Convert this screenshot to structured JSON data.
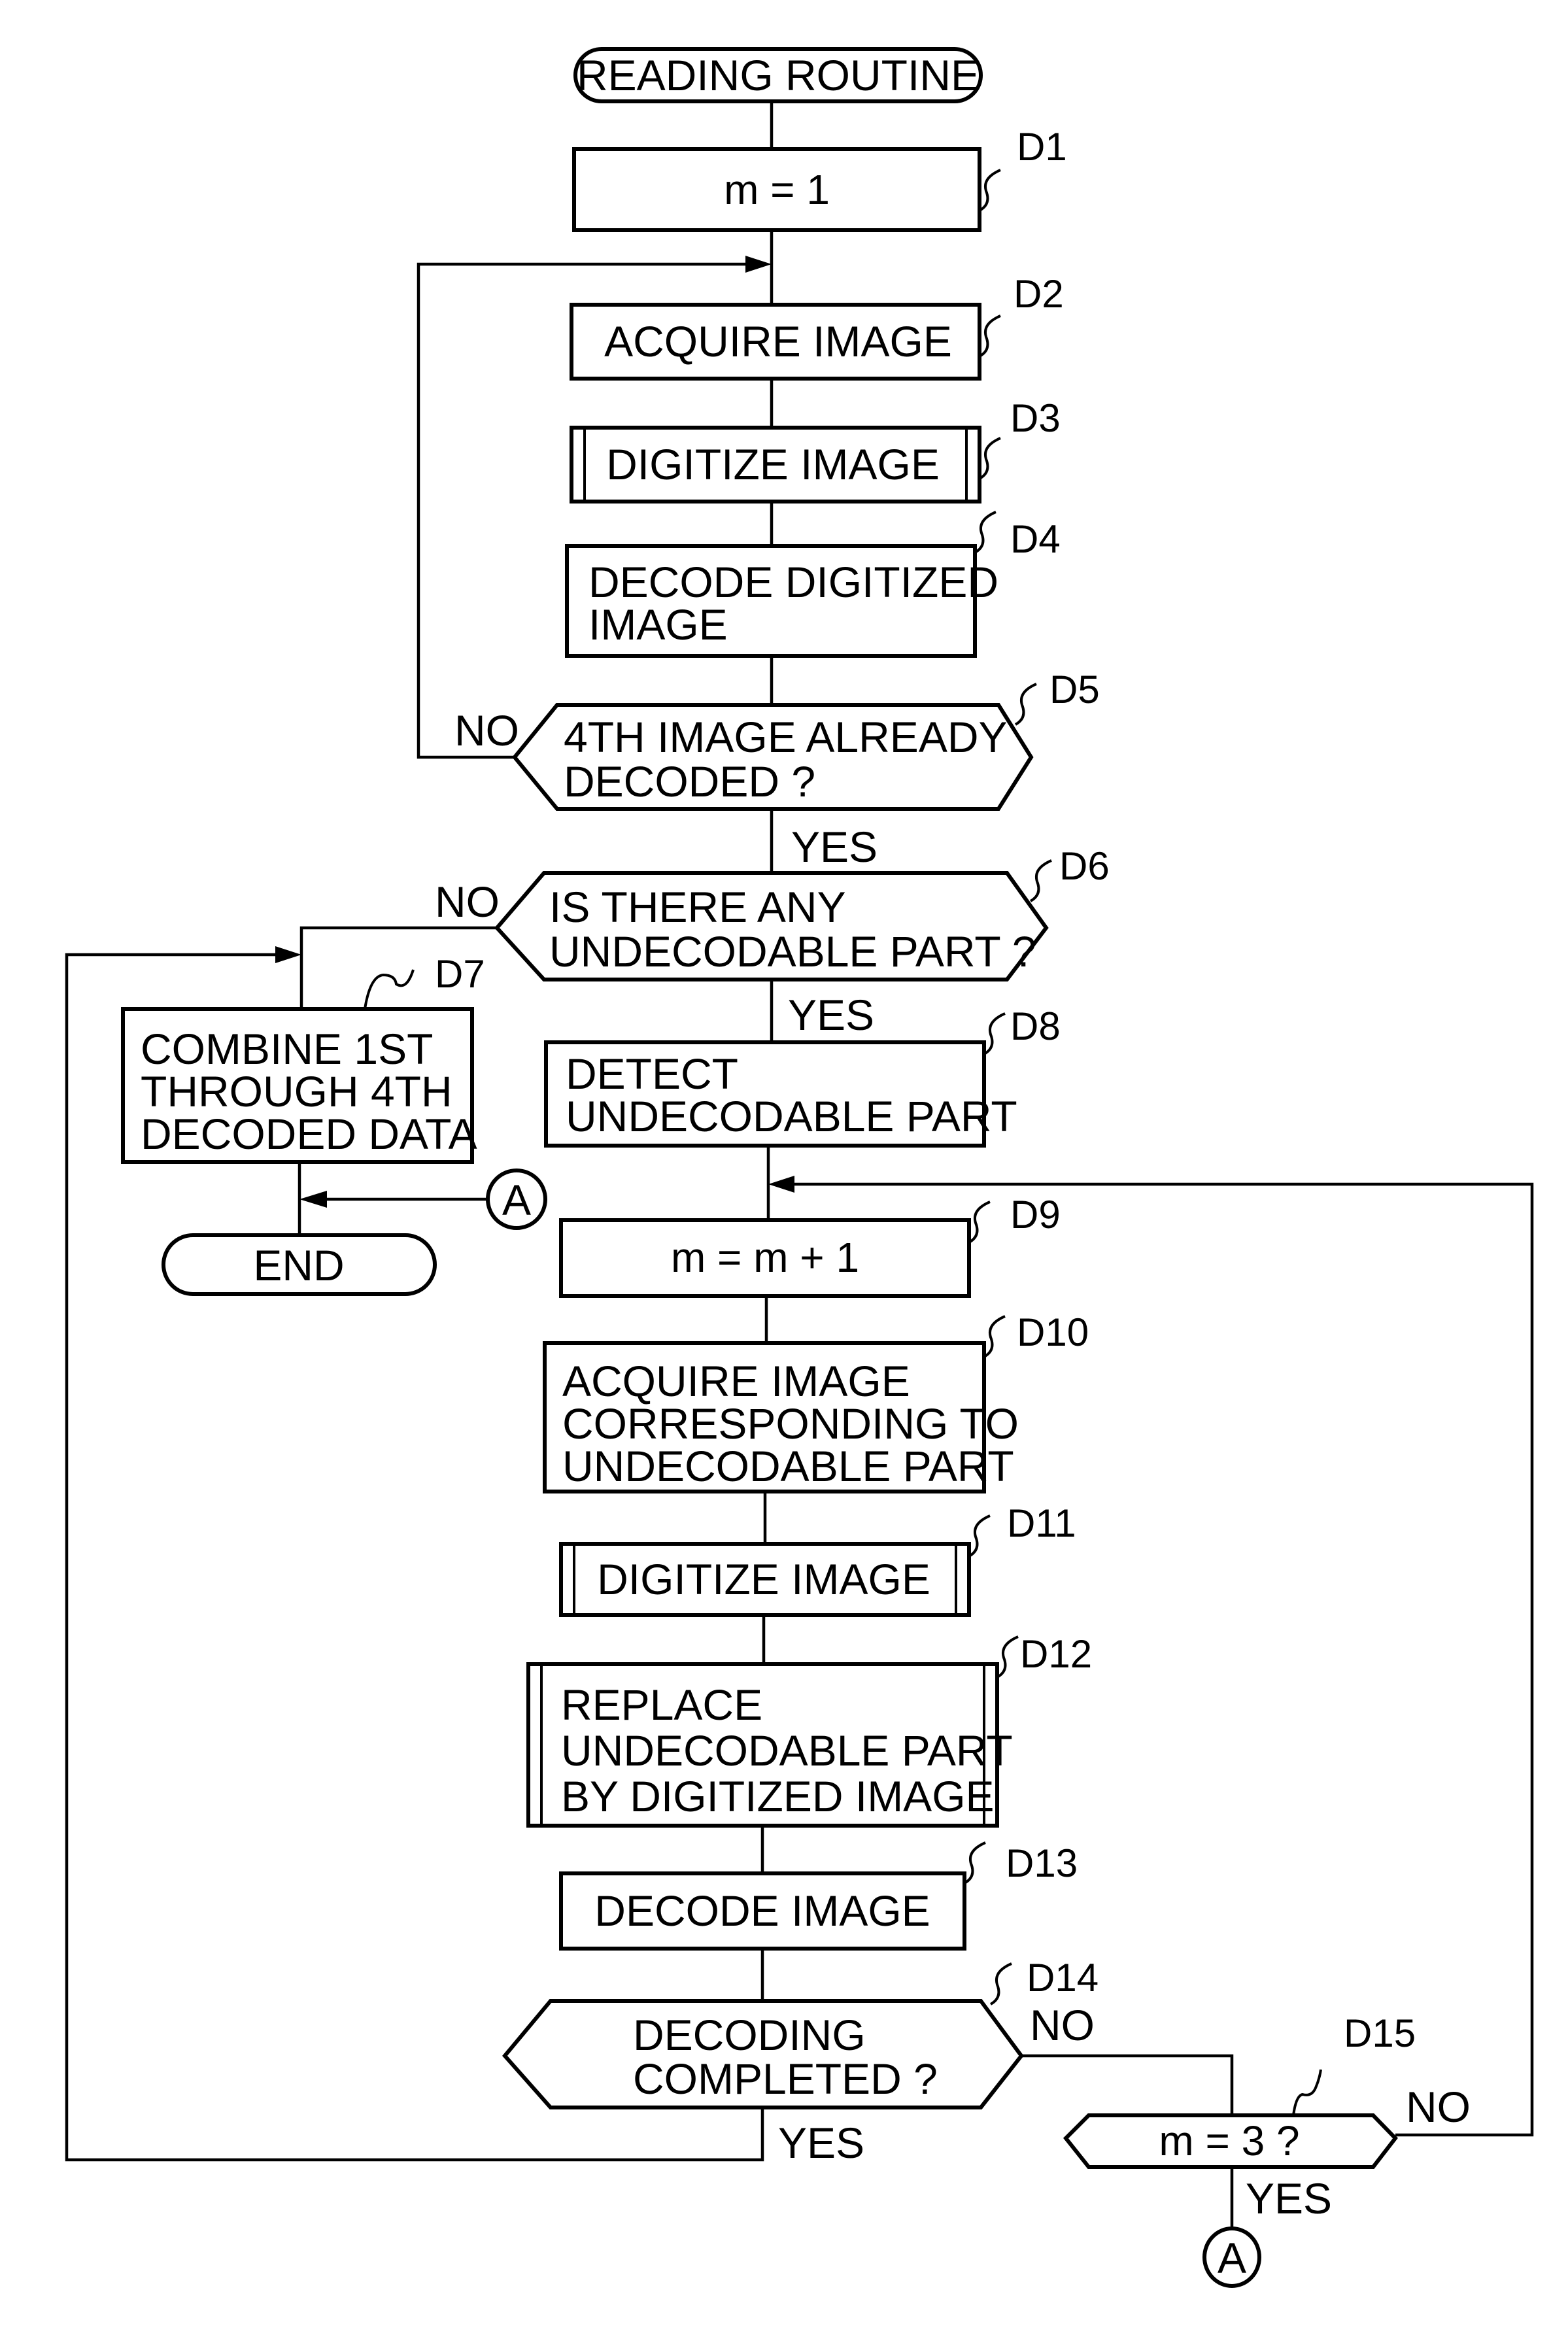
{
  "diagram": {
    "type": "flowchart",
    "start": {
      "label": "READING ROUTINE"
    },
    "end": {
      "label": "END"
    },
    "steps": [
      {
        "id": "D1",
        "kind": "process",
        "lines": [
          "m = 1"
        ]
      },
      {
        "id": "D2",
        "kind": "process",
        "lines": [
          "ACQUIRE IMAGE"
        ]
      },
      {
        "id": "D3",
        "kind": "subroutine",
        "lines": [
          "DIGITIZE IMAGE"
        ]
      },
      {
        "id": "D4",
        "kind": "process",
        "lines": [
          "DECODE DIGITIZED",
          "IMAGE"
        ]
      },
      {
        "id": "D5",
        "kind": "decision",
        "lines": [
          "4TH IMAGE ALREADY",
          "DECODED ?"
        ]
      },
      {
        "id": "D6",
        "kind": "decision",
        "lines": [
          "IS THERE ANY",
          "UNDECODABLE PART ?"
        ]
      },
      {
        "id": "D7",
        "kind": "process",
        "lines": [
          "COMBINE 1ST",
          "THROUGH 4TH",
          "DECODED DATA"
        ]
      },
      {
        "id": "D8",
        "kind": "process",
        "lines": [
          "DETECT",
          "UNDECODABLE PART"
        ]
      },
      {
        "id": "D9",
        "kind": "process",
        "lines": [
          "m = m + 1"
        ]
      },
      {
        "id": "D10",
        "kind": "process",
        "lines": [
          "ACQUIRE IMAGE",
          "CORRESPONDING TO",
          "UNDECODABLE PART"
        ]
      },
      {
        "id": "D11",
        "kind": "subroutine",
        "lines": [
          "DIGITIZE IMAGE"
        ]
      },
      {
        "id": "D12",
        "kind": "subroutine",
        "lines": [
          "REPLACE",
          "UNDECODABLE PART",
          "BY DIGITIZED IMAGE"
        ]
      },
      {
        "id": "D13",
        "kind": "process",
        "lines": [
          "DECODE IMAGE"
        ]
      },
      {
        "id": "D14",
        "kind": "decision",
        "lines": [
          "DECODING",
          "COMPLETED ?"
        ]
      },
      {
        "id": "D15",
        "kind": "decision",
        "lines": [
          "m = 3 ?"
        ]
      }
    ],
    "branch_labels": {
      "d5_no": "NO",
      "d5_yes": "YES",
      "d6_no": "NO",
      "d6_yes": "YES",
      "d14_no": "NO",
      "d14_yes": "YES",
      "d15_no": "NO",
      "d15_yes": "YES"
    },
    "connectors": {
      "a_upper": "A",
      "a_lower": "A"
    },
    "edges": [
      [
        "START",
        "D1"
      ],
      [
        "D1",
        "D2"
      ],
      [
        "D2",
        "D3"
      ],
      [
        "D3",
        "D4"
      ],
      [
        "D4",
        "D5"
      ],
      [
        "D5",
        "D2",
        "NO"
      ],
      [
        "D5",
        "D6",
        "YES"
      ],
      [
        "D6",
        "D7",
        "NO"
      ],
      [
        "D6",
        "D8",
        "YES"
      ],
      [
        "D7",
        "END"
      ],
      [
        "A",
        "END"
      ],
      [
        "D8",
        "D9"
      ],
      [
        "D9",
        "D10"
      ],
      [
        "D10",
        "D11"
      ],
      [
        "D11",
        "D12"
      ],
      [
        "D12",
        "D13"
      ],
      [
        "D13",
        "D14"
      ],
      [
        "D14",
        "D7",
        "YES"
      ],
      [
        "D14",
        "D15",
        "NO"
      ],
      [
        "D15",
        "D9",
        "NO"
      ],
      [
        "D15",
        "A",
        "YES"
      ]
    ]
  }
}
